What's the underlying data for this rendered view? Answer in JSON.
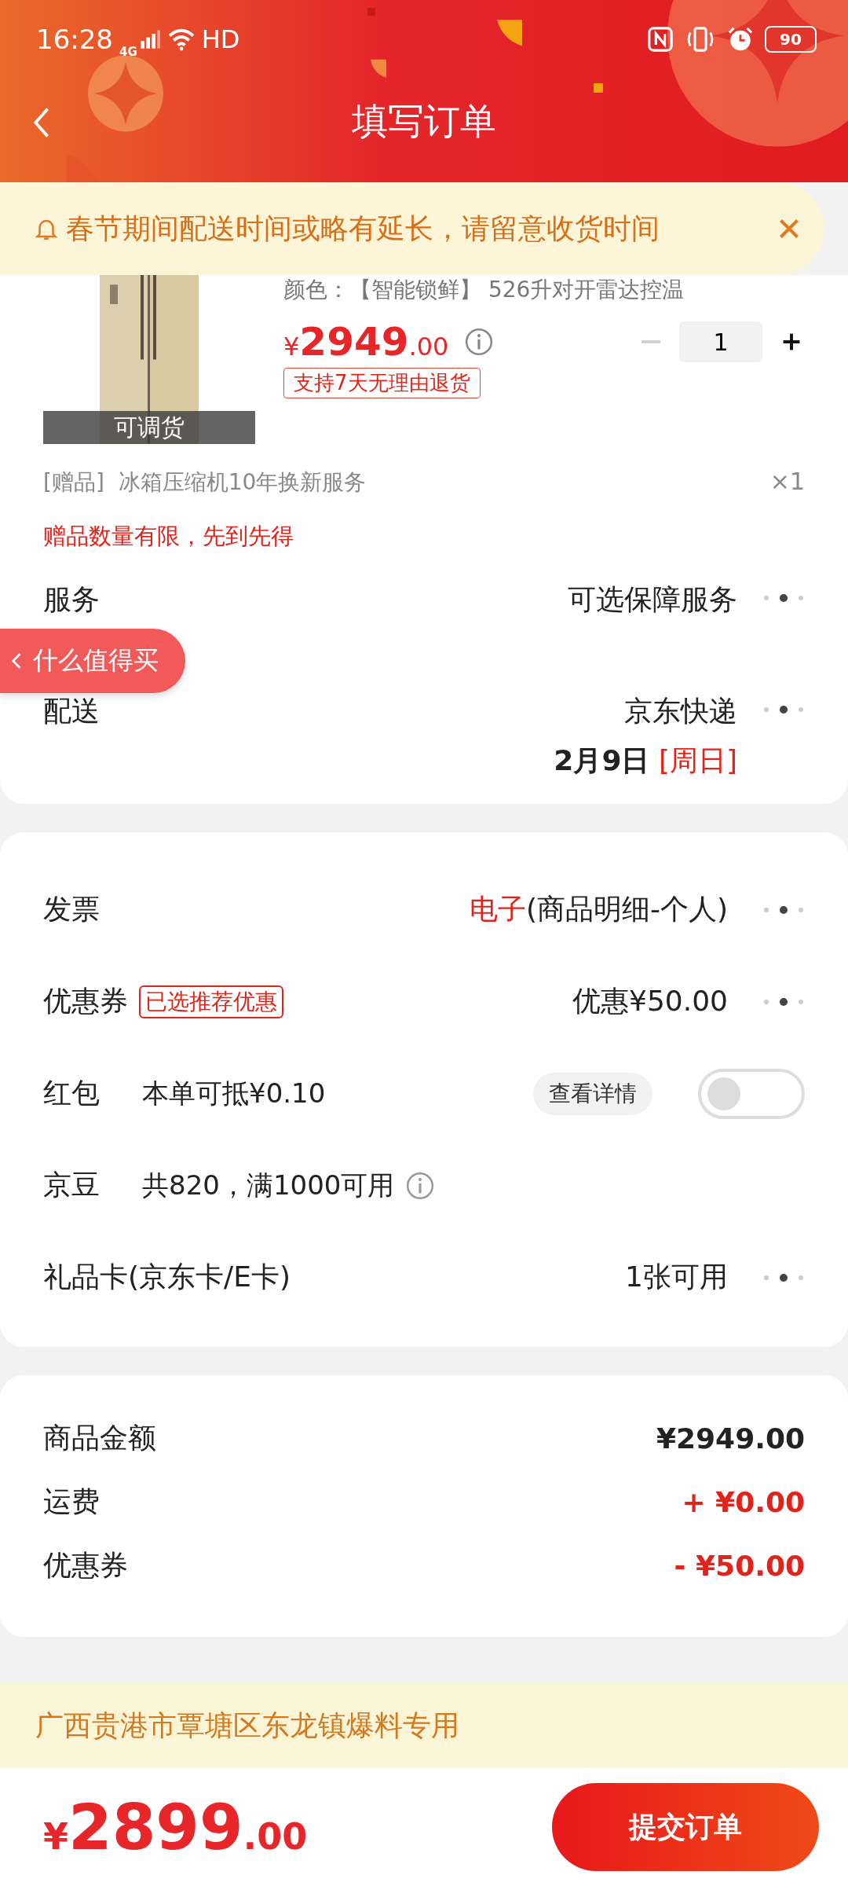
{
  "status_bar": {
    "time": "16:28",
    "network": "4G",
    "hd": "HD",
    "battery": "90"
  },
  "header": {
    "title": "填写订单"
  },
  "notice": {
    "text": "春节期间配送时间或略有延长，请留意收货时间"
  },
  "product": {
    "spec": "颜色：【智能锁鲜】 526升对开雷达控温",
    "currency": "¥",
    "price": "2949",
    "price_decimal": ".00",
    "return_tag": "支持7天无理由退货",
    "quantity": "1",
    "image_label": "可调货"
  },
  "gift": {
    "tag": "[赠品]",
    "name": "冰箱压缩机10年换新服务",
    "count": "×1",
    "note": "赠品数量有限，先到先得"
  },
  "service": {
    "label": "服务",
    "value": "可选保障服务"
  },
  "delivery": {
    "label": "配送",
    "carrier": "京东快递",
    "date": "2月9日",
    "weekday": "[周日]"
  },
  "float_button": {
    "label": "什么值得买"
  },
  "options": [
    {
      "kind": "link",
      "label": "发票",
      "highlight": "电子",
      "value": "(商品明细-个人)"
    },
    {
      "kind": "link",
      "label": "优惠券",
      "badge": "已选推荐优惠",
      "value": "优惠¥50.00"
    },
    {
      "kind": "toggle",
      "label": "红包",
      "desc": "本单可抵¥0.10",
      "detail": "查看详情",
      "on": false
    },
    {
      "kind": "info",
      "label": "京豆",
      "desc": "共820，满1000可用"
    },
    {
      "kind": "link",
      "label": "礼品卡(京东卡/E卡)",
      "value": "1张可用"
    }
  ],
  "summary": [
    {
      "kind": "plain",
      "label": "商品金额",
      "value": "¥2949.00"
    },
    {
      "kind": "charge",
      "label": "运费",
      "value": "+ ¥0.00"
    },
    {
      "kind": "charge",
      "label": "优惠券",
      "value": "- ¥50.00"
    }
  ],
  "address_banner": {
    "text": "广西贵港市覃塘区东龙镇爆料专用"
  },
  "footer": {
    "currency": "¥",
    "total": "2899",
    "decimal": ".00",
    "submit": "提交订单"
  }
}
